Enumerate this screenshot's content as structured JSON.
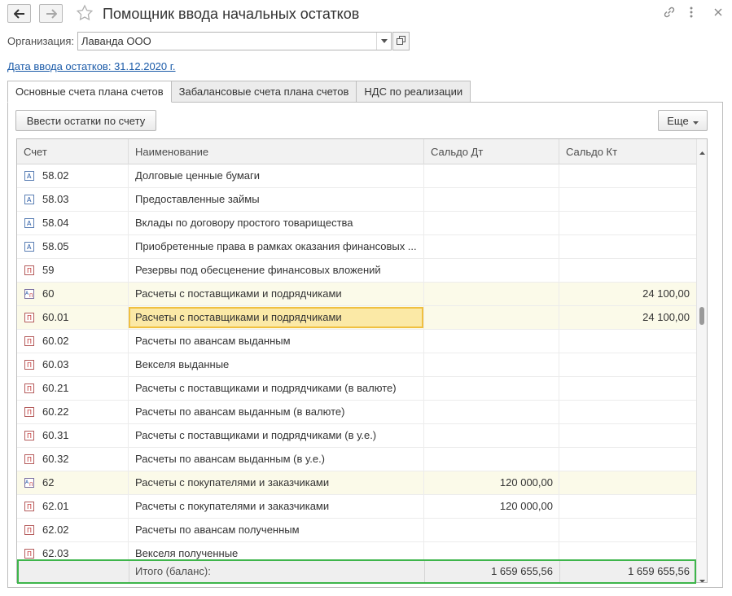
{
  "window": {
    "title": "Помощник ввода начальных остатков"
  },
  "form": {
    "org_label": "Организация:",
    "org_value": "Лаванда ООО",
    "date_link": "Дата ввода остатков: 31.12.2020 г."
  },
  "tabs": [
    {
      "label": "Основные счета плана счетов",
      "active": true
    },
    {
      "label": "Забалансовые счета плана счетов",
      "active": false
    },
    {
      "label": "НДС по реализации",
      "active": false
    }
  ],
  "toolbar": {
    "enter_button": "Ввести остатки по счету",
    "more_button": "Еще"
  },
  "table": {
    "columns": [
      "Счет",
      "Наименование",
      "Сальдо Дт",
      "Сальдо Кт"
    ],
    "rows": [
      {
        "account": "58.02",
        "name": "Долговые ценные бумаги",
        "dt": "",
        "kt": "",
        "icon": "account-active-icon"
      },
      {
        "account": "58.03",
        "name": "Предоставленные займы",
        "dt": "",
        "kt": "",
        "icon": "account-active-icon"
      },
      {
        "account": "58.04",
        "name": "Вклады по договору простого товарищества",
        "dt": "",
        "kt": "",
        "icon": "account-active-icon"
      },
      {
        "account": "58.05",
        "name": "Приобретенные права в рамках оказания финансовых ...",
        "dt": "",
        "kt": "",
        "icon": "account-active-icon"
      },
      {
        "account": "59",
        "name": "Резервы под обесценение финансовых вложений",
        "dt": "",
        "kt": "",
        "icon": "account-passive-icon"
      },
      {
        "account": "60",
        "name": "Расчеты с поставщиками и подрядчиками",
        "dt": "",
        "kt": "24 100,00",
        "icon": "account-active-passive-icon",
        "highlight": true
      },
      {
        "account": "60.01",
        "name": "Расчеты с поставщиками и подрядчиками",
        "dt": "",
        "kt": "24 100,00",
        "icon": "account-passive-icon",
        "highlight": true,
        "selected": true
      },
      {
        "account": "60.02",
        "name": "Расчеты по авансам выданным",
        "dt": "",
        "kt": "",
        "icon": "account-passive-icon"
      },
      {
        "account": "60.03",
        "name": "Векселя выданные",
        "dt": "",
        "kt": "",
        "icon": "account-passive-icon"
      },
      {
        "account": "60.21",
        "name": "Расчеты с поставщиками и подрядчиками (в валюте)",
        "dt": "",
        "kt": "",
        "icon": "account-passive-icon"
      },
      {
        "account": "60.22",
        "name": "Расчеты по авансам выданным (в валюте)",
        "dt": "",
        "kt": "",
        "icon": "account-passive-icon"
      },
      {
        "account": "60.31",
        "name": "Расчеты с поставщиками и подрядчиками (в у.е.)",
        "dt": "",
        "kt": "",
        "icon": "account-passive-icon"
      },
      {
        "account": "60.32",
        "name": "Расчеты по авансам выданным (в у.е.)",
        "dt": "",
        "kt": "",
        "icon": "account-passive-icon"
      },
      {
        "account": "62",
        "name": "Расчеты с покупателями и заказчиками",
        "dt": "120 000,00",
        "kt": "",
        "icon": "account-active-passive-icon",
        "highlight": true
      },
      {
        "account": "62.01",
        "name": "Расчеты с покупателями и заказчиками",
        "dt": "120 000,00",
        "kt": "",
        "icon": "account-passive-icon"
      },
      {
        "account": "62.02",
        "name": "Расчеты по авансам полученным",
        "dt": "",
        "kt": "",
        "icon": "account-passive-icon"
      },
      {
        "account": "62.03",
        "name": "Векселя полученные",
        "dt": "",
        "kt": "",
        "icon": "account-passive-icon"
      }
    ],
    "footer": {
      "label": "Итого (баланс):",
      "dt": "1 659 655,56",
      "kt": "1 659 655,56"
    }
  },
  "colors": {
    "highlight_row": "#fbfae9",
    "selected_cell": "#fbe9a6",
    "selected_border": "#f0c040",
    "footer_outline": "#3eb54b",
    "link": "#1a5aa8"
  }
}
